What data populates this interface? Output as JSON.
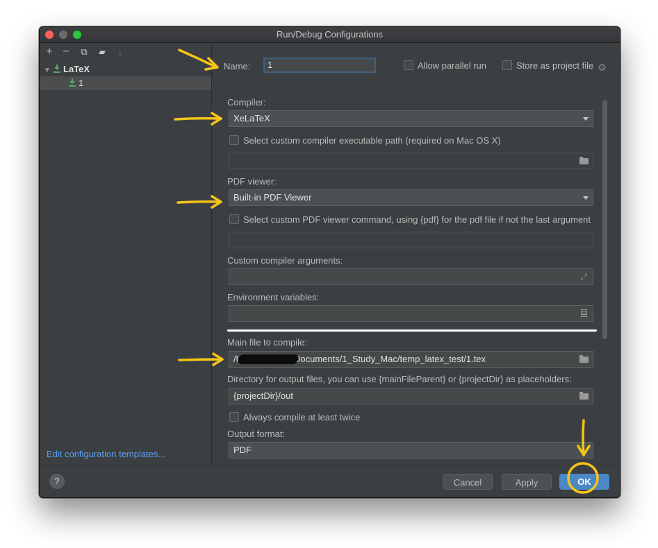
{
  "window": {
    "title": "Run/Debug Configurations"
  },
  "sidebar": {
    "toolbar": [
      "add-icon",
      "remove-icon",
      "copy-icon",
      "new-folder-icon",
      "sort-icon"
    ],
    "tree": {
      "group_label": "LaTeX",
      "item_label": "1"
    },
    "edit_templates_link": "Edit configuration templates..."
  },
  "form": {
    "name_label": "Name:",
    "name_value": "1",
    "allow_parallel_label": "Allow parallel run",
    "store_project_label": "Store as project file",
    "compiler_label": "Compiler:",
    "compiler_value": "XeLaTeX",
    "custom_compiler_label": "Select custom compiler executable path (required on Mac OS X)",
    "pdf_viewer_label": "PDF viewer:",
    "pdf_viewer_value": "Built-in PDF Viewer",
    "custom_pdf_label": "Select custom PDF viewer command, using {pdf} for the pdf file if not the last argument",
    "compiler_args_label": "Custom compiler arguments:",
    "env_vars_label": "Environment variables:",
    "main_file_label": "Main file to compile:",
    "main_file_value_prefix": "/U",
    "main_file_value_suffix": "Documents/1_Study_Mac/temp_latex_test/1.tex",
    "output_dir_label": "Directory for output files, you can use {mainFileParent} or {projectDir} as placeholders:",
    "output_dir_value": "{projectDir}/out",
    "compile_twice_label": "Always compile at least twice",
    "output_format_label": "Output format:",
    "output_format_value": "PDF"
  },
  "footer": {
    "help_label": "?",
    "cancel_label": "Cancel",
    "apply_label": "Apply",
    "ok_label": "OK"
  },
  "colors": {
    "annotation": "#f5c518",
    "ok_button": "#4a88c7",
    "link": "#589df6"
  }
}
